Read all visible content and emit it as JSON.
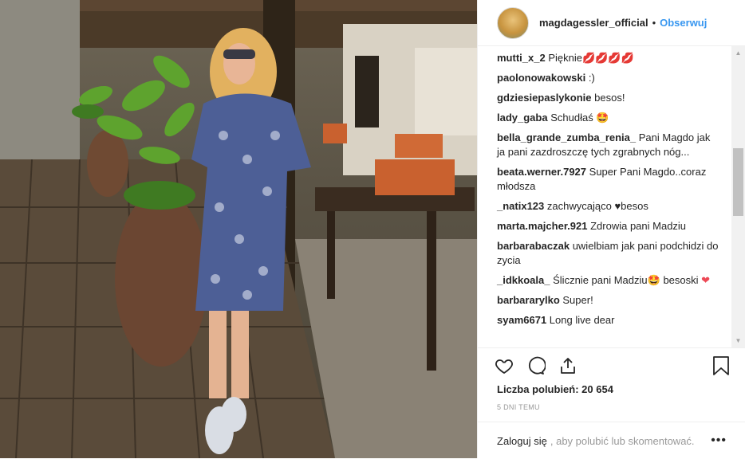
{
  "header": {
    "username": "magdagessler_official",
    "separator": "•",
    "follow_label": "Obserwuj"
  },
  "comments": [
    {
      "user": "mutti_x_2",
      "text": "Pięknie",
      "emoji": "💋💋💋💋"
    },
    {
      "user": "paolonowakowski",
      "text": ":)"
    },
    {
      "user": "gdziesiepaslykonie",
      "text": "besos!"
    },
    {
      "user": "lady_gaba",
      "text": "Schudłaś",
      "emoji": "🤩"
    },
    {
      "user": "bella_grande_zumba_renia_",
      "text": "Pani Magdo jak ja pani zazdroszczę tych zgrabnych nóg..."
    },
    {
      "user": "beata.werner.7927",
      "text": "Super Pani Magdo..coraz młodsza"
    },
    {
      "user": "_natix123",
      "text": "zachwycająco",
      "emoji": "♥",
      "text2": "besos"
    },
    {
      "user": "marta.majcher.921",
      "text": "Zdrowia pani Madziu"
    },
    {
      "user": "barbarabaczak",
      "text": "uwielbiam jak pani podchidzi do zycia"
    },
    {
      "user": "_idkkoala_",
      "text": "Ślicznie pani Madziu",
      "emoji": "🤩",
      "text2": "besoski",
      "emoji2": "❤"
    },
    {
      "user": "barbararylko",
      "text": "Super!"
    },
    {
      "user": "syam6671",
      "text": "Long live dear"
    }
  ],
  "actions": {
    "likes": "Liczba polubień: 20 654",
    "time": "5 DNI TEMU"
  },
  "footer": {
    "login_link": "Zaloguj się",
    "login_text": ", aby polubić lub skomentować.",
    "more": "•••"
  },
  "scrollbar": {
    "up": "▲",
    "down": "▼"
  },
  "colors": {
    "accent": "#3897f0",
    "text": "#262626",
    "muted": "#999999",
    "heart": "#ed4956"
  }
}
